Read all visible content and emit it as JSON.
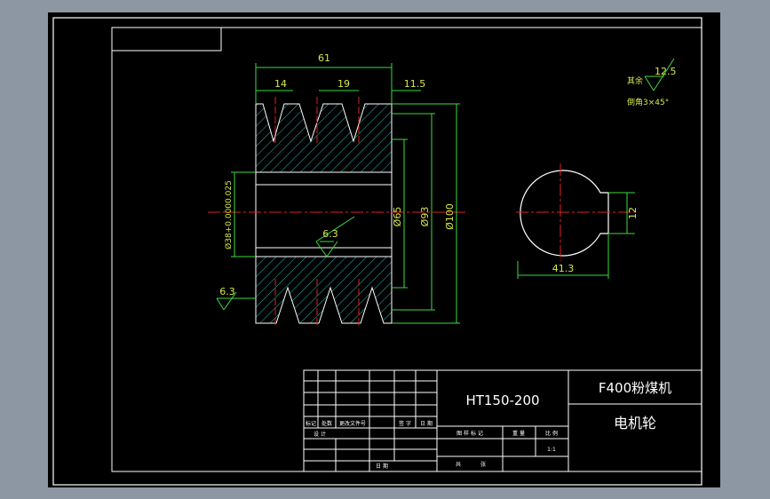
{
  "drawing": {
    "dimensions": {
      "overall_width": "61",
      "groove_top_width": "14",
      "groove_pitch": "19",
      "edge_offset": "11.5",
      "bore_diameter": "Ø38+0.0000.025",
      "hub_diameter": "Ø65",
      "pitch_diameter": "Ø93",
      "outer_diameter": "Ø100",
      "roughness_bore": "6.3",
      "roughness_face": "6.3",
      "keyway_width": "12",
      "keyway_depth": "41.3"
    },
    "notes": {
      "rest_label": "其余",
      "rest_roughness": "12.5",
      "chamfer_label": "倒角",
      "chamfer_value": "3×45°"
    }
  },
  "title_block": {
    "material": "HT150-200",
    "project": "F400粉煤机",
    "part_name": "电机轮",
    "scale": "1:1",
    "labels": {
      "mark": "标记",
      "count": "处数",
      "change_doc": "更改文件号",
      "sign": "签 字",
      "date": "日 期",
      "design": "设 计",
      "stage_mark": "图 样 标 记",
      "weight": "重 量",
      "ratio": "比 例",
      "sheets": "共",
      "sheet": "张",
      "date2": "日 期"
    }
  }
}
